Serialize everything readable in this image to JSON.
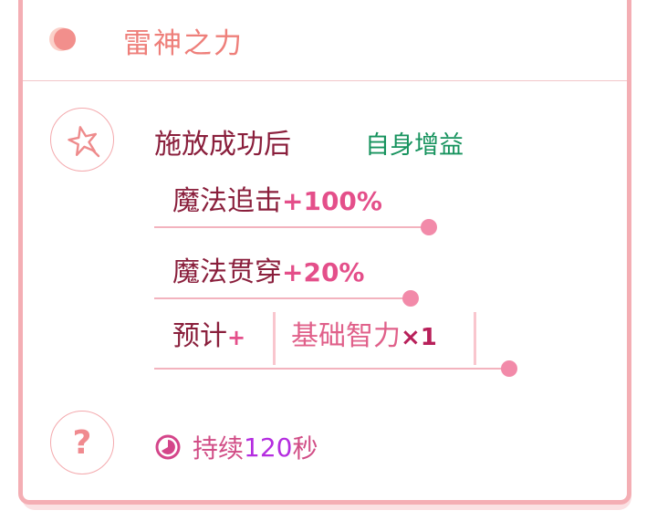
{
  "header": {
    "title": "雷神之力",
    "icon": "moon-ball-icon"
  },
  "effect": {
    "trigger": "施放成功后",
    "tag": "自身增益",
    "stats": [
      {
        "label": "魔法追击",
        "value": "+100%"
      },
      {
        "label": "魔法贯穿",
        "value": "+20%"
      }
    ],
    "estimate": {
      "label": "预计",
      "plus": "+",
      "formula": "基础智力",
      "multiplier": "×1"
    }
  },
  "duration": {
    "prefix": "持续",
    "number": "120",
    "unit": "秒"
  },
  "colors": {
    "accent": "#f4aeb4",
    "title": "#ee7f7a",
    "text": "#8a1f3c",
    "buff": "#17935e",
    "value": "#e44f8a"
  }
}
